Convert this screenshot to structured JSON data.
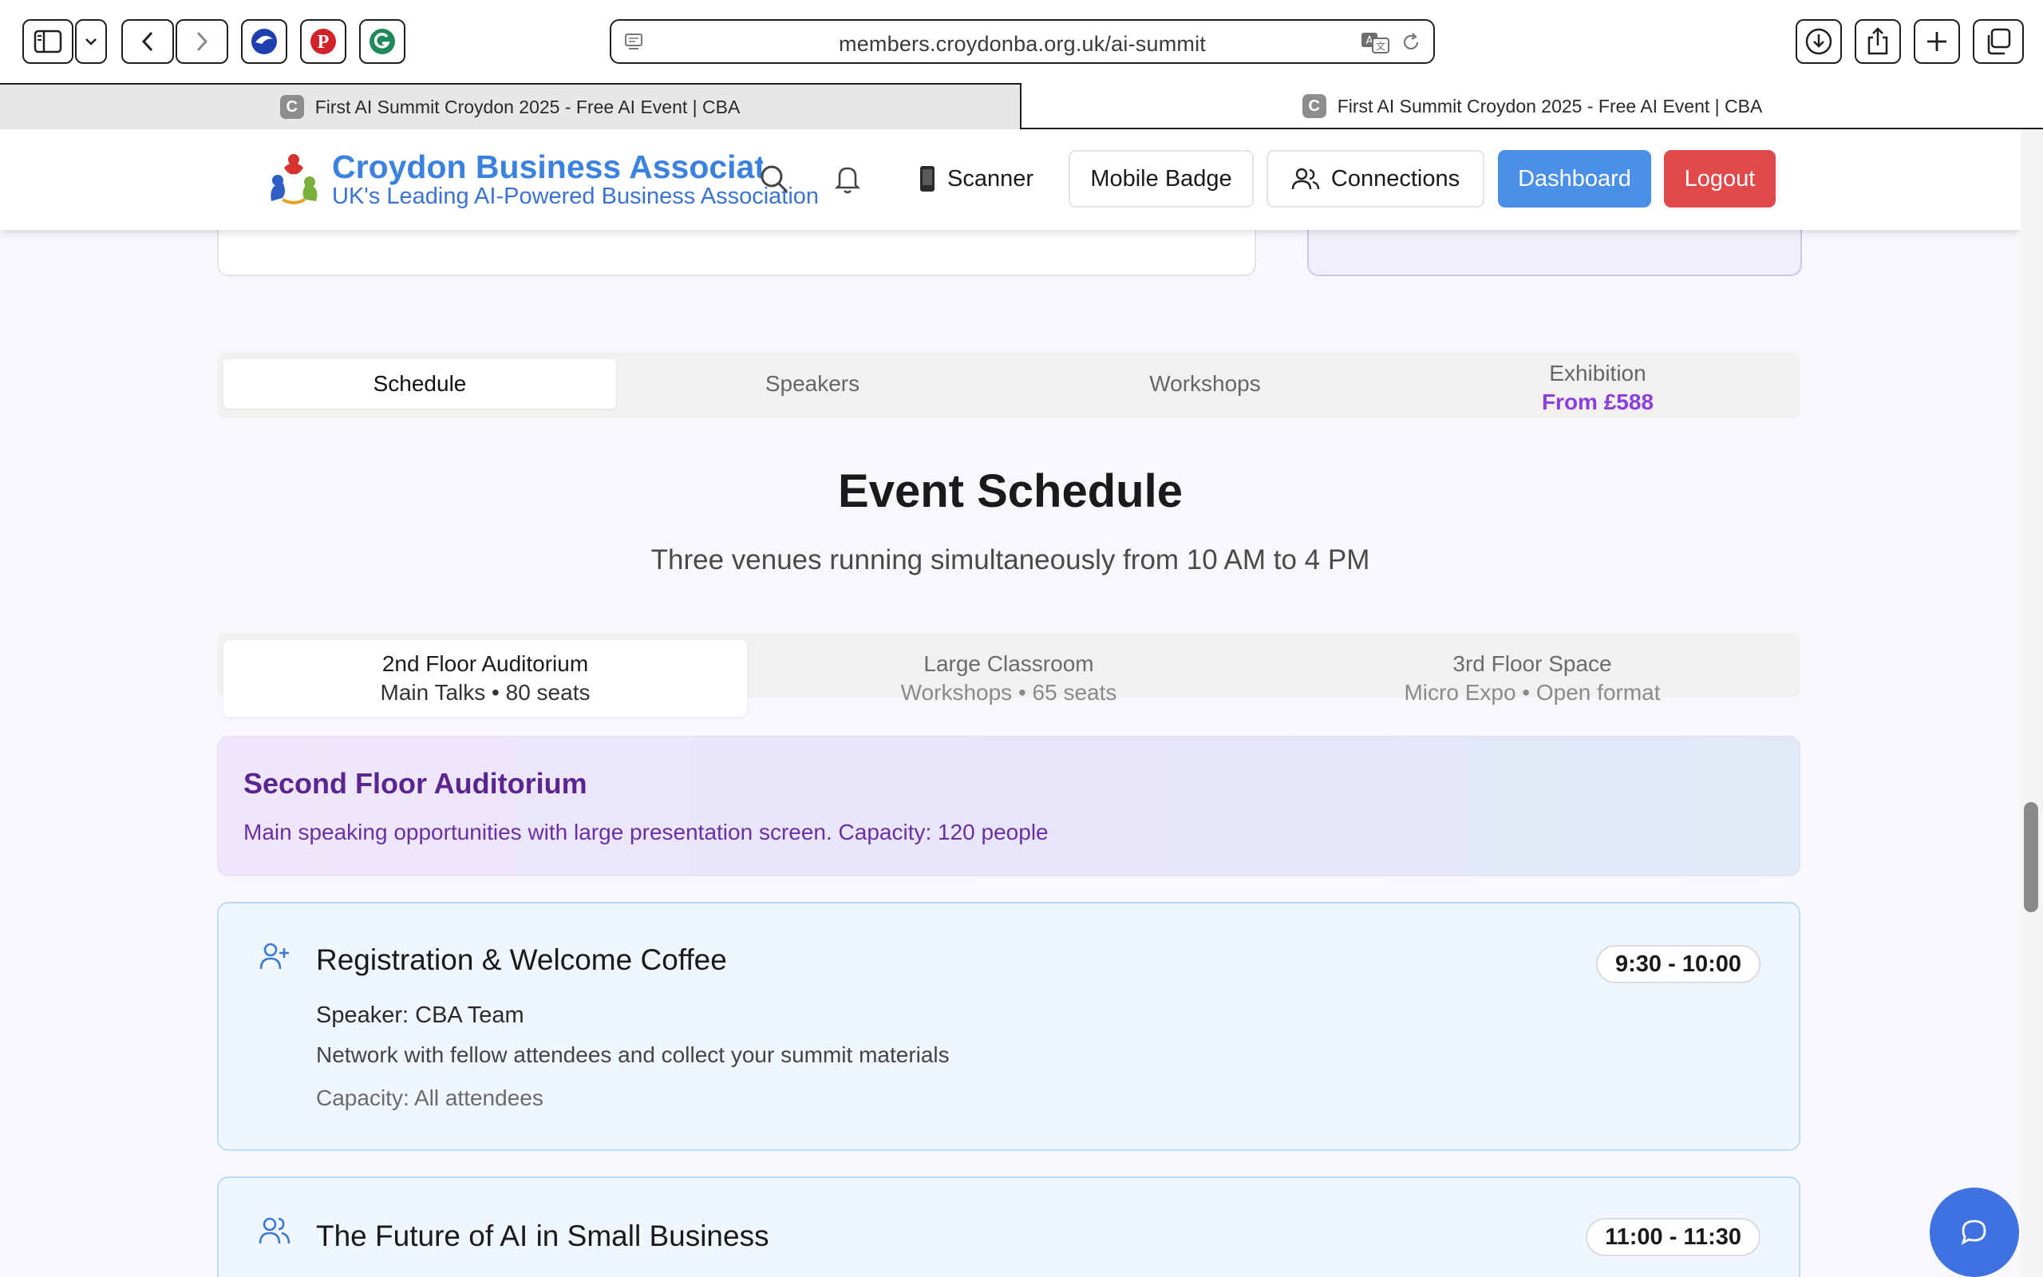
{
  "browser": {
    "url": "members.croydonba.org.uk/ai-summit",
    "tabs": [
      {
        "title": "First AI Summit Croydon 2025 - Free AI Event | CBA",
        "favicon": "C",
        "active": false
      },
      {
        "title": "First AI Summit Croydon 2025 - Free AI Event | CBA",
        "favicon": "C",
        "active": true
      }
    ]
  },
  "header": {
    "brand_name": "Croydon Business Association",
    "brand_tagline": "UK's Leading AI-Powered Business Association",
    "nav": {
      "scanner": "Scanner",
      "mobile_badge": "Mobile Badge",
      "connections": "Connections",
      "dashboard": "Dashboard",
      "logout": "Logout"
    }
  },
  "main_tabs": [
    {
      "label": "Schedule",
      "active": true
    },
    {
      "label": "Speakers",
      "active": false
    },
    {
      "label": "Workshops",
      "active": false
    },
    {
      "label": "Exhibition",
      "sub": "From £588",
      "active": false
    }
  ],
  "schedule": {
    "title": "Event Schedule",
    "subtitle": "Three venues running simultaneously from 10 AM to 4 PM"
  },
  "venue_tabs": [
    {
      "name": "2nd Floor Auditorium",
      "detail": "Main Talks • 80 seats",
      "active": true
    },
    {
      "name": "Large Classroom",
      "detail": "Workshops • 65 seats",
      "active": false
    },
    {
      "name": "3rd Floor Space",
      "detail": "Micro Expo • Open format",
      "active": false
    }
  ],
  "venue_banner": {
    "title": "Second Floor Auditorium",
    "description": "Main speaking opportunities with large presentation screen. Capacity: 120 people"
  },
  "sessions": [
    {
      "icon": "user-plus-icon",
      "title": "Registration & Welcome Coffee",
      "time": "9:30 - 10:00",
      "speaker": "Speaker: CBA Team",
      "description": "Network with fellow attendees and collect your summit materials",
      "capacity": "Capacity: All attendees"
    },
    {
      "icon": "users-icon",
      "title": "The Future of AI in Small Business",
      "time": "11:00 - 11:30"
    }
  ],
  "colors": {
    "accent_blue": "#4a90e8",
    "logout_red": "#e04a48",
    "exhibition_purple": "#8b3fe0",
    "banner_purple": "#5a2590"
  }
}
